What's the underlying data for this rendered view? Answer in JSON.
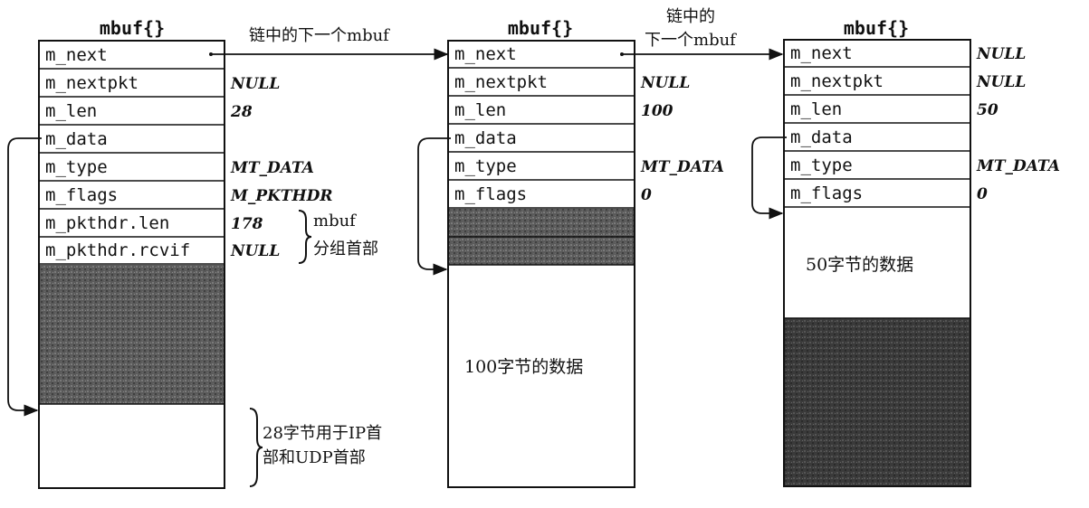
{
  "mbufs": [
    {
      "title": "mbuf{}",
      "fields": [
        "m_next",
        "m_nextpkt",
        "m_len",
        "m_data",
        "m_type",
        "m_flags",
        "m_pkthdr.len",
        "m_pkthdr.rcvif"
      ],
      "values": [
        "",
        "NULL",
        "28",
        "",
        "MT_DATA",
        "M_PKTHDR",
        "178",
        "NULL"
      ],
      "brace_label_line1": "mbuf",
      "brace_label_line2": "分组首部",
      "data_label_line1": "28字节用于IP首",
      "data_label_line2": "部和UDP首部"
    },
    {
      "title": "mbuf{}",
      "fields": [
        "m_next",
        "m_nextpkt",
        "m_len",
        "m_data",
        "m_type",
        "m_flags"
      ],
      "values": [
        "",
        "NULL",
        "100",
        "",
        "MT_DATA",
        "0"
      ],
      "data_label": "100字节的数据"
    },
    {
      "title": "mbuf{}",
      "fields": [
        "m_next",
        "m_nextpkt",
        "m_len",
        "m_data",
        "m_type",
        "m_flags"
      ],
      "values": [
        "NULL",
        "NULL",
        "50",
        "",
        "MT_DATA",
        "0"
      ],
      "data_label": "50字节的数据"
    }
  ],
  "arrow1_label": "链中的下一个mbuf",
  "arrow2_label_line1": "链中的",
  "arrow2_label_line2": "下一个mbuf",
  "colors": {
    "ink": "#111111",
    "shade": "#555555",
    "shade_dark": "#3a3a3a"
  }
}
